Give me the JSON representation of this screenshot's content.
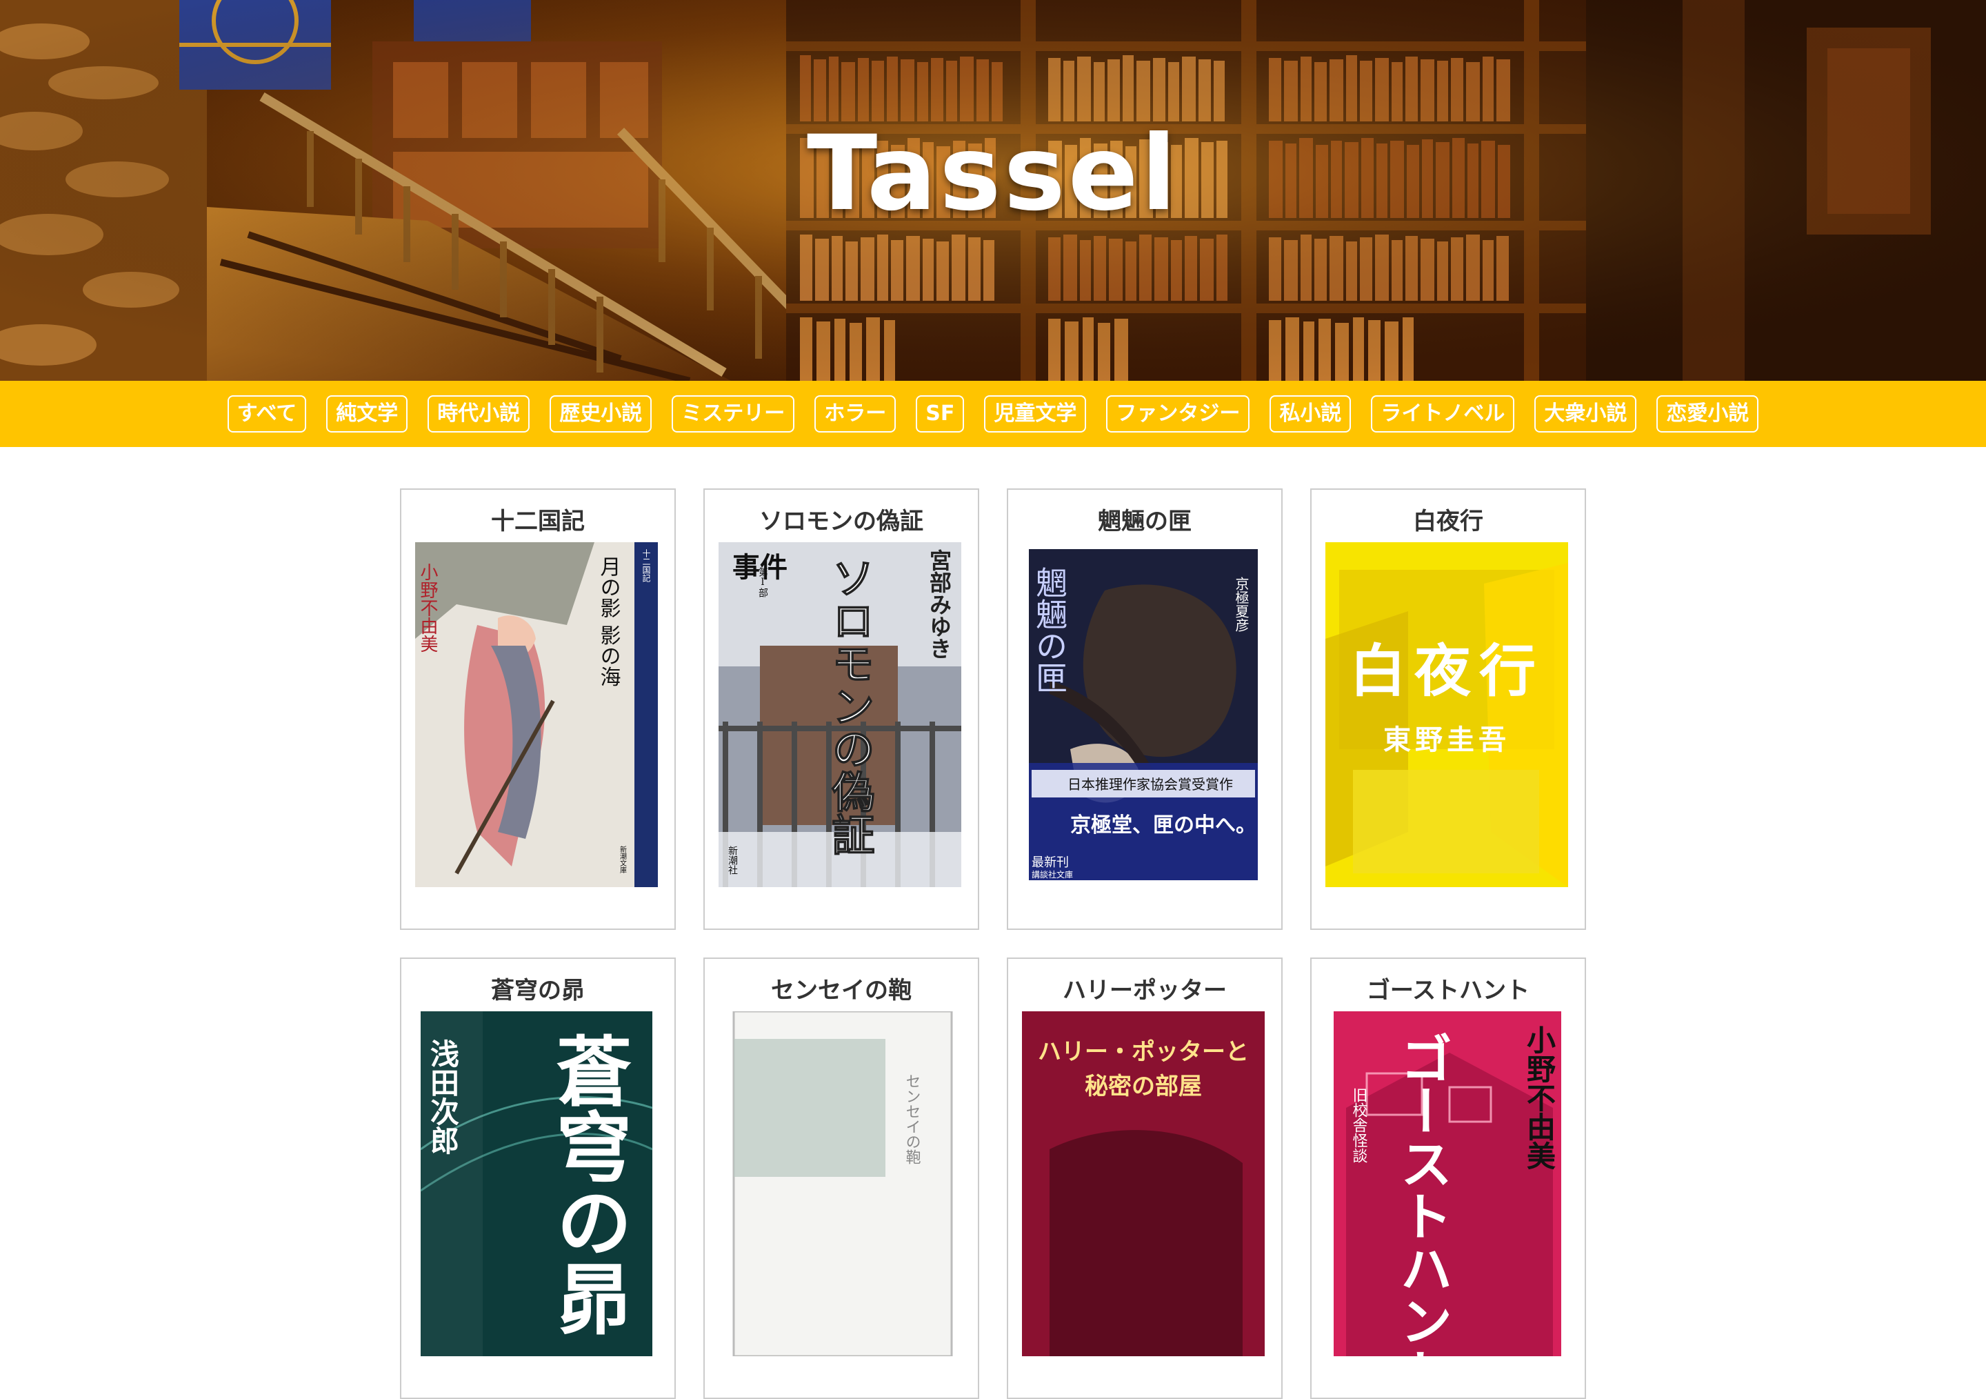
{
  "site": {
    "title": "Tassel"
  },
  "categories": [
    "すべて",
    "純文学",
    "時代小説",
    "歴史小説",
    "ミステリー",
    "ホラー",
    "SF",
    "児童文学",
    "ファンタジー",
    "私小説",
    "ライトノベル",
    "大衆小説",
    "恋愛小説"
  ],
  "books": [
    {
      "title": "十二国記",
      "cover": {
        "bg": "#e8e4dc",
        "accent": "#1c2f6e",
        "vtext": [
          "月の影 影の海",
          "小野不由美",
          "十二国記",
          "新潮文庫"
        ]
      }
    },
    {
      "title": "ソロモンの偽証",
      "cover": {
        "bg": "#c9ccd3",
        "accent": "#3b3b3b",
        "vtext": [
          "ソロモンの偽証",
          "宮部みゆき",
          "事件",
          "第Ⅰ部",
          "新潮社"
        ]
      }
    },
    {
      "title": "魍魎の匣",
      "cover": {
        "bg": "#1b1f3a",
        "accent": "#2a3aa0",
        "vtext": [
          "魍魎の匣",
          "京極夏彦",
          "日本推理作家協会賞受賞作",
          "京極堂、匣の中へ。",
          "最新刊",
          "講談社文庫"
        ]
      }
    },
    {
      "title": "白夜行",
      "cover": {
        "bg": "#f5e000",
        "accent": "#ffffff",
        "vtext": [
          "白夜行",
          "東野圭吾"
        ]
      }
    },
    {
      "title": "蒼穹の昴",
      "cover": {
        "bg": "#0d3b3a",
        "accent": "#ffffff",
        "vtext": [
          "蒼穹の昴",
          "浅田次郎"
        ]
      }
    },
    {
      "title": "センセイの鞄",
      "cover": {
        "bg": "#f4f4f2",
        "accent": "#a9b8b0",
        "vtext": [
          "センセイの鞄"
        ]
      }
    },
    {
      "title": "ハリーポッター",
      "cover": {
        "bg": "#7a0f2a",
        "accent": "#ffd34a",
        "vtext": [
          "ハリー・ポッターと",
          "秘密の部屋"
        ]
      }
    },
    {
      "title": "ゴーストハント",
      "cover": {
        "bg": "#c8124a",
        "accent": "#ffffff",
        "vtext": [
          "ゴーストハント",
          "小野不由美",
          "旧校舎怪談"
        ]
      }
    }
  ],
  "colors": {
    "bar": "#ffc400",
    "card_border": "#cccccc",
    "title_text": "#333333"
  }
}
